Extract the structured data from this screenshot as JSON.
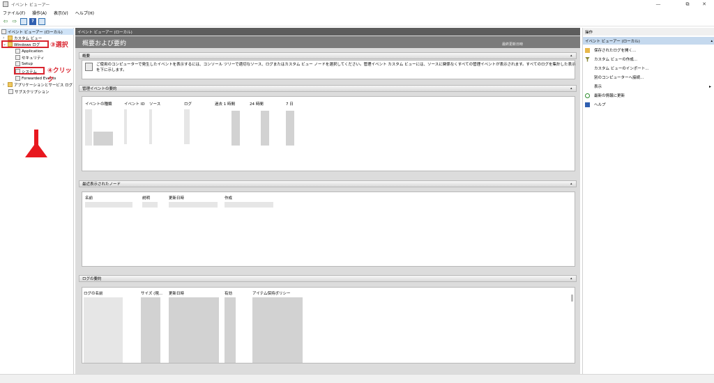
{
  "window": {
    "title": "イベント ビューアー",
    "controls": [
      "—",
      "⧉",
      "✕"
    ]
  },
  "menu": [
    "ファイル(F)",
    "操作(A)",
    "表示(V)",
    "ヘルプ(H)"
  ],
  "tree": {
    "root": "イベント ビューアー (ローカル)",
    "custom_views": "カスタム ビュー",
    "windows_logs": "Windows ログ",
    "application": "Application",
    "security": "セキュリティ",
    "setup": "Setup",
    "system": "システム",
    "forwarded": "Forwarded Events",
    "app_service_logs": "アプリケーションとサービス ログ",
    "subscriptions": "サブスクリプション"
  },
  "annotations": {
    "step3": "③選択",
    "step4": "④クリック"
  },
  "center": {
    "header": "イベント ビューアー (ローカル)",
    "banner_title": "概要および要約",
    "last_refreshed": "最終更新日時",
    "overview": {
      "title": "概要",
      "text": "ご使用のコンピューターで発生したイベントを表示するには、コンソール ツリーで適切なソース、ログまたはカスタム ビュー ノードを選択してください。管理イベント カスタム ビューには、ソースに関係なくすべての管理イベントが表示されます。すべてのログを集計した表示を下に示します。"
    },
    "admin_events": {
      "title": "管理イベントの要約",
      "columns": [
        "イベントの種類",
        "イベント ID",
        "ソース",
        "ログ",
        "過去 1 時間",
        "24 時間",
        "7 日"
      ]
    },
    "recent_nodes": {
      "title": "最近表示されたノード",
      "columns": [
        "名前",
        "説明",
        "更新日時",
        "作成"
      ]
    },
    "log_summary": {
      "title": "ログの要約",
      "columns": [
        "ログの名前",
        "サイズ (現...",
        "更新日時",
        "有効",
        "アイテム保持ポリシー"
      ]
    }
  },
  "actions": {
    "header": "操作",
    "section": "イベント ビューアー (ローカル)",
    "items": [
      {
        "label": "保存されたログを開く...",
        "icon": "folder-open-icon"
      },
      {
        "label": "カスタム ビューの作成...",
        "icon": "filter-icon"
      },
      {
        "label": "カスタム ビューのインポート...",
        "icon": ""
      },
      {
        "label": "別のコンピューターへ接続...",
        "icon": ""
      },
      {
        "label": "表示",
        "icon": ""
      },
      {
        "label": "最新の情報に更新",
        "icon": "refresh-icon"
      },
      {
        "label": "ヘルプ",
        "icon": "help-icon"
      }
    ]
  },
  "colors": {
    "accent_red": "#d9232e",
    "selection": "#cfe3f7",
    "header_gray": "#5d5d5d"
  }
}
